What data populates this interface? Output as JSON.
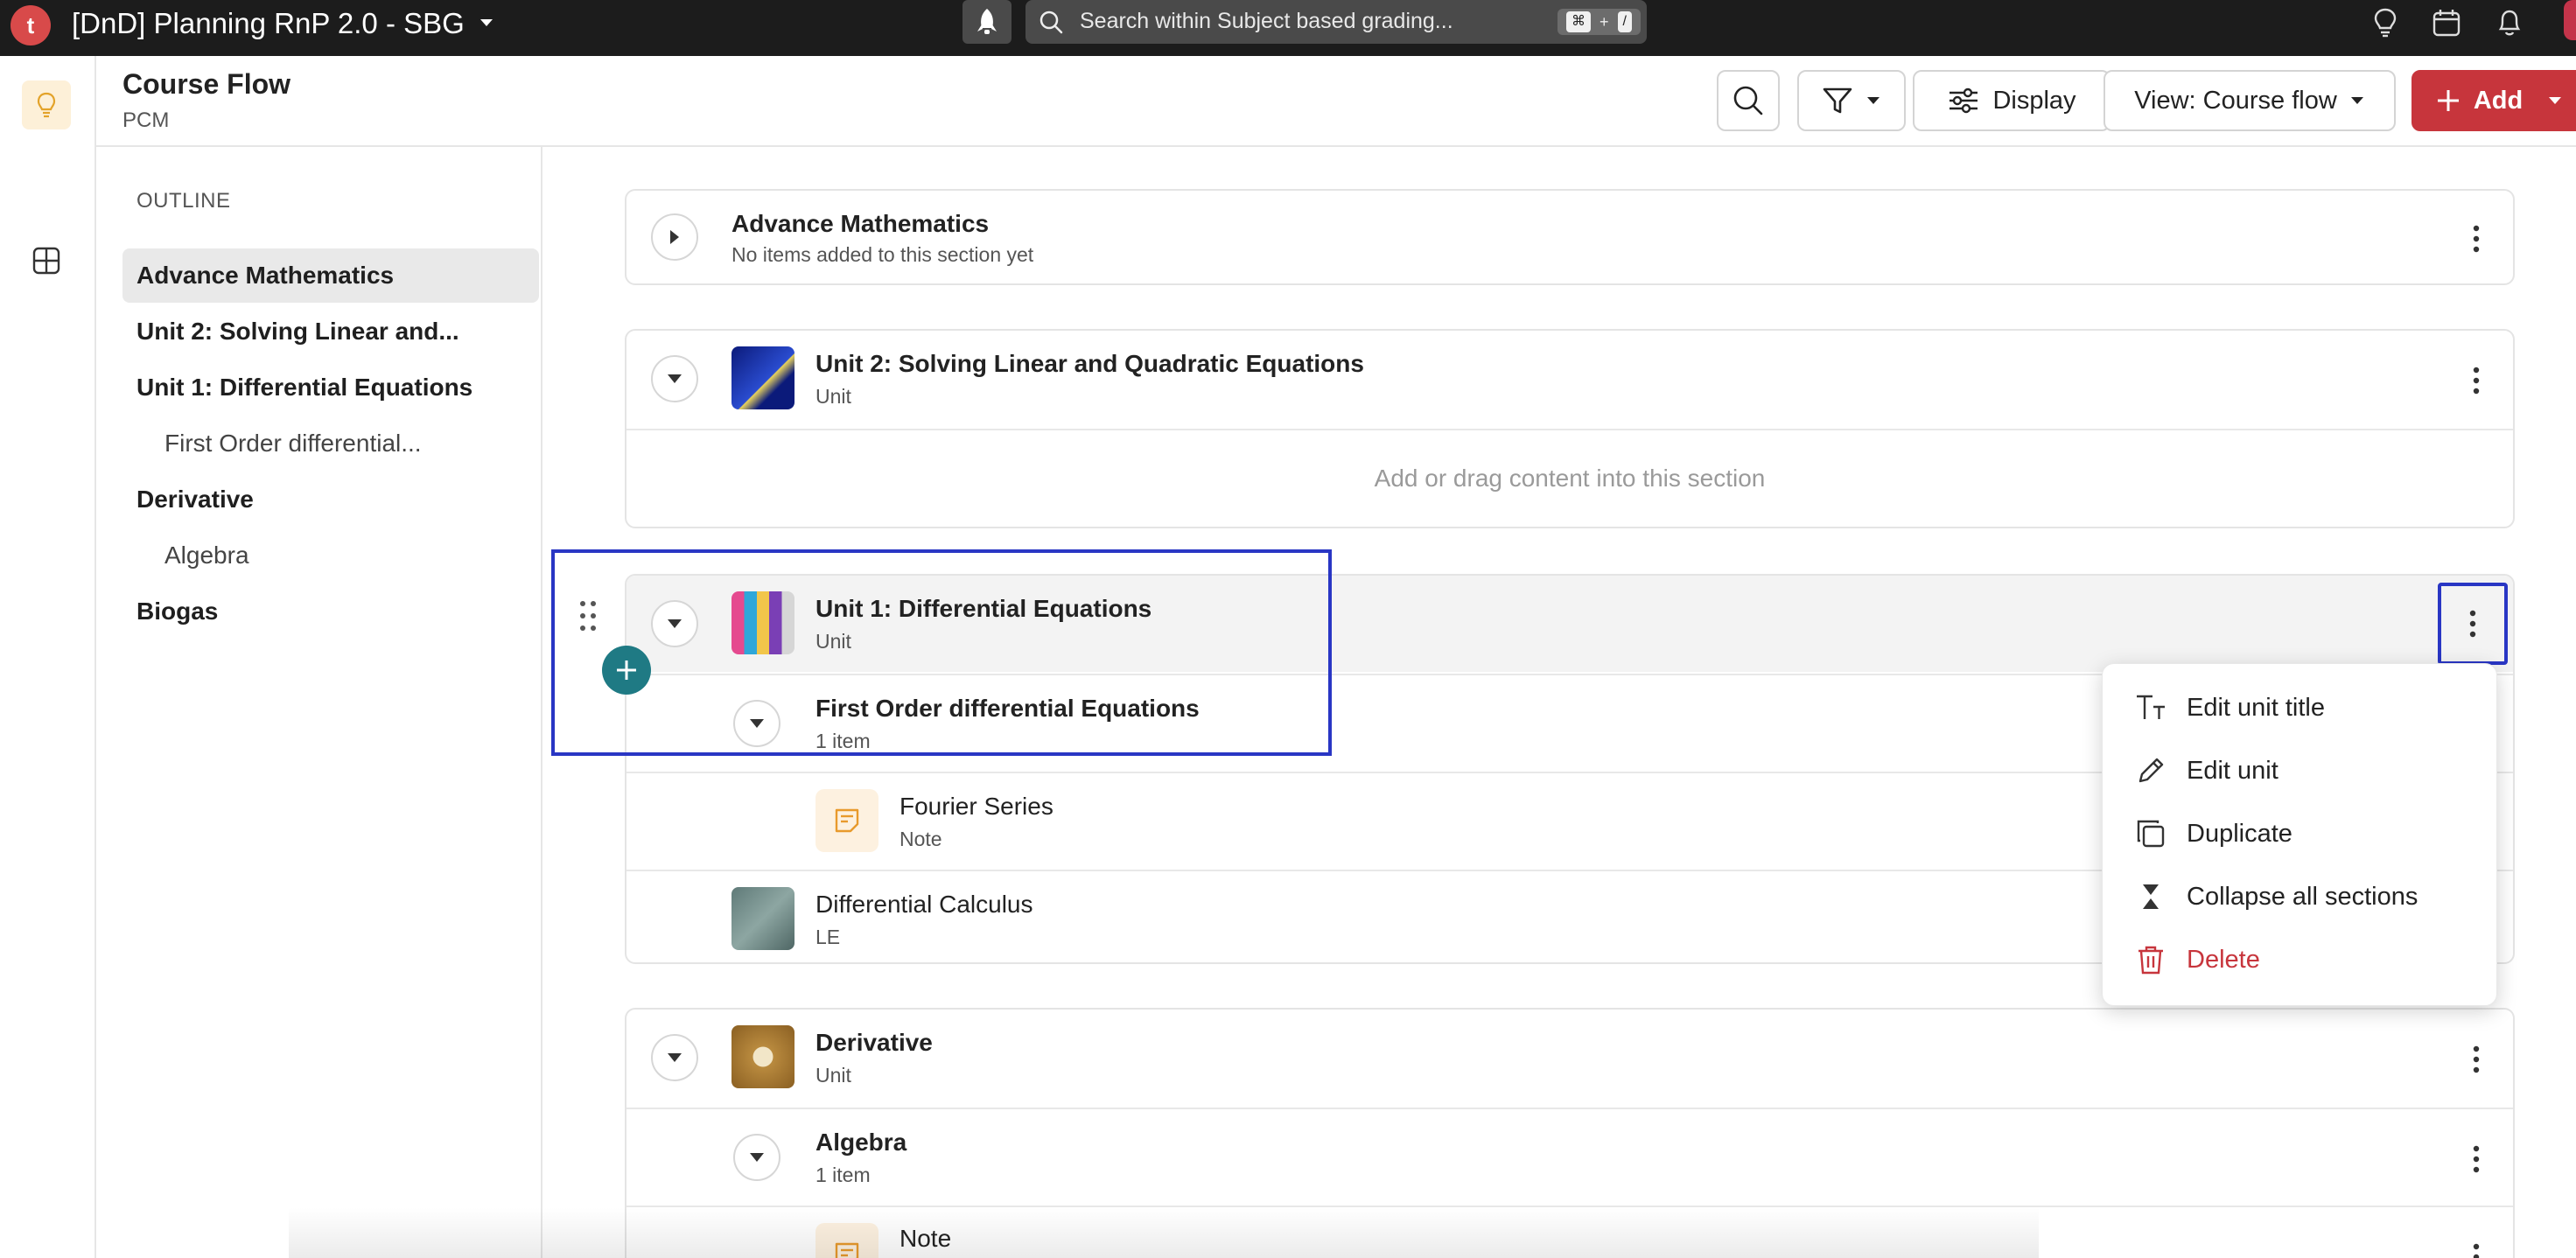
{
  "topbar": {
    "logo_letter": "t",
    "app_title": "[DnD] Planning RnP 2.0 - SBG",
    "search_placeholder": "Search within Subject based grading...",
    "shortcut_cmd": "⌘",
    "shortcut_plus": "+",
    "shortcut_slash": "/",
    "icons": [
      "lightbulb-icon",
      "calendar-icon",
      "bell-icon"
    ]
  },
  "header": {
    "title": "Course Flow",
    "subtitle": "PCM",
    "display_label": "Display",
    "view_label": "View: Course flow",
    "add_label": "Add"
  },
  "outline": {
    "label": "OUTLINE",
    "items": [
      {
        "label": "Advance Mathematics"
      },
      {
        "label": "Unit 2: Solving Linear and..."
      },
      {
        "label": "Unit 1: Differential Equations"
      },
      {
        "label": "First Order differential..."
      },
      {
        "label": "Derivative"
      },
      {
        "label": "Algebra"
      },
      {
        "label": "Biogas"
      }
    ]
  },
  "sections": {
    "advance": {
      "title": "Advance Mathematics",
      "subtitle": "No items added to this section yet"
    },
    "unit2": {
      "title": "Unit 2: Solving Linear and Quadratic Equations",
      "subtitle": "Unit",
      "empty_hint": "Add or drag content into this section"
    },
    "unit1": {
      "title": "Unit 1: Differential Equations",
      "subtitle": "Unit",
      "subsection": {
        "title": "First Order differential Equations",
        "subtitle": "1 item"
      },
      "note": {
        "title": "Fourier Series",
        "subtitle": "Note"
      },
      "le": {
        "title": "Differential Calculus",
        "subtitle": "LE"
      }
    },
    "derivative": {
      "title": "Derivative",
      "subtitle": "Unit",
      "subsection": {
        "title": "Algebra",
        "subtitle": "1 item"
      },
      "note": {
        "title": "Note"
      }
    }
  },
  "context_menu": {
    "items": [
      {
        "label": "Edit unit title",
        "icon": "text-title-icon"
      },
      {
        "label": "Edit unit",
        "icon": "pencil-icon"
      },
      {
        "label": "Duplicate",
        "icon": "duplicate-icon"
      },
      {
        "label": "Collapse all sections",
        "icon": "collapse-icon"
      },
      {
        "label": "Delete",
        "icon": "trash-icon"
      }
    ]
  },
  "colors": {
    "accent_red": "#c7353c",
    "selection_blue": "#2936c4",
    "fab_teal": "#1f7a84",
    "topbar_bg": "#1c1c1c"
  }
}
